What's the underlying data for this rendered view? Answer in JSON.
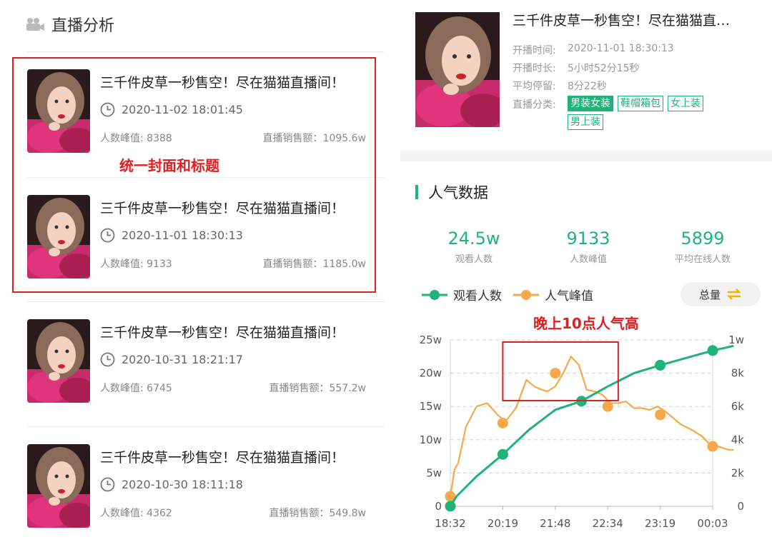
{
  "left": {
    "title": "直播分析",
    "note": "统一封面和标题",
    "streams": [
      {
        "title": "三千件皮草一秒售空！尽在猫猫直播间！",
        "time": "2020-11-02 18:01:45",
        "peak": "人数峰值: 8388",
        "sales": "直播销售额：1095.6w"
      },
      {
        "title": "三千件皮草一秒售空！尽在猫猫直播间！",
        "time": "2020-11-01 18:30:13",
        "peak": "人数峰值: 9133",
        "sales": "直播销售额：1185.0w"
      },
      {
        "title": "三千件皮草一秒售空！尽在猫猫直播间！",
        "time": "2020-10-31 18:21:17",
        "peak": "人数峰值: 6745",
        "sales": "直播销售额：557.2w"
      },
      {
        "title": "三千件皮草一秒售空！尽在猫猫直播间！",
        "time": "2020-10-30 18:11:18",
        "peak": "人数峰值: 4362",
        "sales": "直播销售额：549.8w"
      }
    ]
  },
  "right": {
    "title": "三千件皮草一秒售空！尽在猫猫直…",
    "info": [
      {
        "label": "开播时间:",
        "value": "2020-11-01 18:30:13"
      },
      {
        "label": "开播时长:",
        "value": "5小时52分15秒"
      },
      {
        "label": "平均停留:",
        "value": "8分22秒"
      },
      {
        "label": "直播分类:",
        "value": ""
      }
    ],
    "tags": [
      "男装女装",
      "鞋帽箱包",
      "女上装",
      "男上装"
    ],
    "section_title": "人气数据",
    "stats": [
      {
        "value": "24.5w",
        "caption": "观看人数"
      },
      {
        "value": "9133",
        "caption": "人数峰值"
      },
      {
        "value": "5899",
        "caption": "平均在线人数"
      }
    ],
    "legend": [
      "观看人数",
      "人气峰值"
    ],
    "total_button": "总量",
    "chart_note": "晚上10点人气高",
    "colors": {
      "accent": "#1fb37a",
      "orange": "#f5a94a",
      "annotation": "#e02020"
    }
  },
  "chart_data": {
    "type": "line",
    "x_ticks": [
      "18:32",
      "20:19",
      "21:48",
      "22:34",
      "23:19",
      "00:03"
    ],
    "y_left_ticks": [
      "0",
      "5w",
      "10w",
      "15w",
      "20w",
      "25w"
    ],
    "y_right_ticks": [
      "0",
      "2k",
      "4k",
      "6k",
      "8k",
      "1w"
    ],
    "ylim_left": [
      0,
      25
    ],
    "ylim_right": [
      0,
      10000
    ],
    "series": [
      {
        "name": "观看人数",
        "axis": "left",
        "unit": "w",
        "x": [
          0,
          0.12,
          0.5,
          1.0,
          1.5,
          2.0,
          2.5,
          3.0,
          3.5,
          4.0,
          4.5,
          5.0,
          5.4
        ],
        "values": [
          0,
          1.5,
          4.5,
          7.8,
          11.5,
          14.5,
          15.8,
          18.0,
          20.0,
          21.2,
          22.3,
          23.4,
          24.1
        ],
        "markers": [
          0,
          3,
          6,
          9,
          11,
          13
        ]
      },
      {
        "name": "人气峰值",
        "axis": "right",
        "x": [
          0,
          0.08,
          0.15,
          0.3,
          0.5,
          0.7,
          0.9,
          1.05,
          1.25,
          1.45,
          1.6,
          1.75,
          1.85,
          2.0,
          2.15,
          2.3,
          2.45,
          2.6,
          2.75,
          2.9,
          3.05,
          3.2,
          3.35,
          3.5,
          3.65,
          3.8,
          3.95,
          4.1,
          4.25,
          4.4,
          4.6,
          4.8,
          4.95,
          5.1,
          5.3,
          5.4
        ],
        "values": [
          600,
          2200,
          2600,
          4800,
          6000,
          6200,
          5500,
          5100,
          5900,
          7600,
          7200,
          7000,
          6900,
          7200,
          8000,
          9000,
          8500,
          7000,
          6900,
          6700,
          6200,
          6200,
          6300,
          5900,
          5900,
          5800,
          6000,
          5700,
          5300,
          4900,
          4600,
          4200,
          3700,
          3600,
          3400,
          3400
        ],
        "marker_x": [
          0,
          1,
          2,
          3,
          4,
          5
        ],
        "marker_values": [
          600,
          5000,
          8000,
          6000,
          5500,
          3600
        ]
      }
    ]
  }
}
